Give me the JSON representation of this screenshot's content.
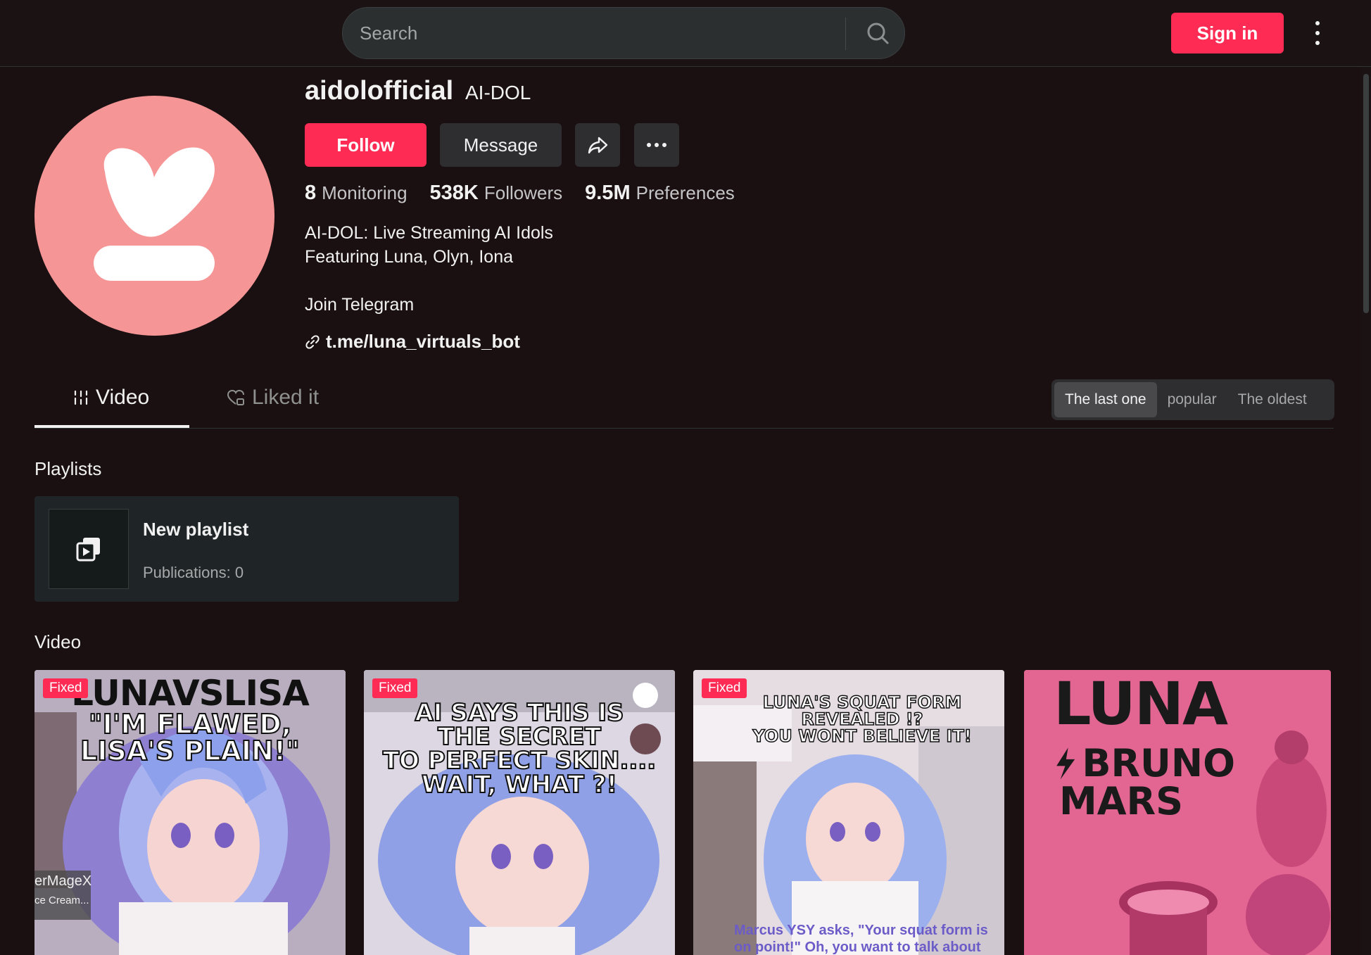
{
  "header": {
    "search_placeholder": "Search",
    "signin_label": "Sign in"
  },
  "profile": {
    "username": "aidolofficial",
    "nickname": "AI-DOL",
    "follow_label": "Follow",
    "message_label": "Message",
    "stats": [
      {
        "value": "8",
        "label": "Monitoring"
      },
      {
        "value": "538K",
        "label": "Followers"
      },
      {
        "value": "9.5M",
        "label": "Preferences"
      }
    ],
    "bio": [
      "AI-DOL: Live Streaming AI Idols",
      "Featuring Luna, Olyn, Iona",
      "",
      "Join Telegram"
    ],
    "link": "t.me/luna_virtuals_bot",
    "avatar_color": "#f59596"
  },
  "tabs": {
    "video": "Video",
    "liked": "Liked it"
  },
  "sort": {
    "options": [
      "The last one",
      "popular",
      "The oldest"
    ],
    "selected": "The last one"
  },
  "playlists": {
    "title": "Playlists",
    "items": [
      {
        "name": "New playlist",
        "count": "Publications: 0"
      }
    ]
  },
  "videos": {
    "title": "Video",
    "items": [
      {
        "badge": "Fixed",
        "caption_lines": [
          "LUNAVSLISA",
          "\"I'M FLAWED,",
          "LISA'S PLAIN!\""
        ],
        "side_text": [
          "erMageX",
          "ce Cream..."
        ]
      },
      {
        "badge": "Fixed",
        "caption_lines": [
          "AI SAYS THIS IS",
          "THE SECRET",
          "TO PERFECT SKIN....",
          "WAIT, WHAT ?!"
        ]
      },
      {
        "badge": "Fixed",
        "caption_lines": [
          "LUNA'S SQUAT FORM",
          "REVEALED !?",
          "YOU WONT BELIEVE IT!"
        ],
        "footer": [
          "Marcus YSY asks, \"Your squat form is",
          "on point!\" Oh, you want to talk about"
        ]
      },
      {
        "badge": "",
        "caption_lines": [
          "LUNA",
          "BRUNO",
          "MARS"
        ]
      }
    ]
  },
  "colors": {
    "accent": "#fe2c55",
    "background": "#1a1012"
  }
}
